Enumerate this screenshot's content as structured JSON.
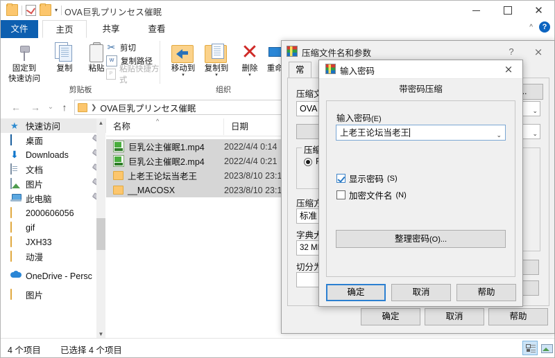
{
  "explorer": {
    "title": "OVA巨乳プリンセス催眠",
    "quick_access_icons": [
      "folder-icon",
      "properties-icon",
      "new-folder-icon",
      "customize-caret-icon"
    ],
    "window_buttons": {
      "minimize": "minimize-icon",
      "maximize": "maximize-icon",
      "close": "close-icon"
    },
    "help_expand": "^",
    "help": "?",
    "tabs": [
      {
        "label": "文件",
        "name": "tab-file"
      },
      {
        "label": "主页",
        "name": "tab-home"
      },
      {
        "label": "共享",
        "name": "tab-share"
      },
      {
        "label": "查看",
        "name": "tab-view"
      }
    ],
    "ribbon": {
      "groups": [
        {
          "name": "剪贴板"
        },
        {
          "name": "组织"
        }
      ],
      "clipboard": {
        "pin_label_line1": "固定到",
        "pin_label_line2": "快速访问",
        "copy": "复制",
        "paste": "粘贴",
        "cut": "剪切",
        "copy_path": "复制路径",
        "paste_shortcut": "粘贴快捷方式"
      },
      "organize": {
        "move_to": "移动到",
        "copy_to": "复制到",
        "delete": "删除",
        "rename": "重命名"
      }
    },
    "address": {
      "back": "←",
      "forward": "→",
      "recent": "⌄",
      "up": "↑",
      "crumb": "OVA巨乳プリンセス催眠",
      "dropdown": "⌄"
    },
    "nav_pane": {
      "items": [
        {
          "label": "快速访问",
          "icon": "star-icon",
          "selected": true,
          "pinned": false
        },
        {
          "label": "桌面",
          "icon": "desktop-icon",
          "selected": false,
          "pinned": true
        },
        {
          "label": "Downloads",
          "icon": "download-icon",
          "selected": false,
          "pinned": true
        },
        {
          "label": "文档",
          "icon": "documents-icon",
          "selected": false,
          "pinned": true
        },
        {
          "label": "图片",
          "icon": "pictures-icon",
          "selected": false,
          "pinned": true
        },
        {
          "label": "此电脑",
          "icon": "this-pc-icon",
          "selected": false,
          "pinned": true
        },
        {
          "label": "2000606056",
          "icon": "folder-icon",
          "selected": false,
          "pinned": false
        },
        {
          "label": "gif",
          "icon": "folder-icon",
          "selected": false,
          "pinned": false
        },
        {
          "label": "JXH33",
          "icon": "folder-icon",
          "selected": false,
          "pinned": false
        },
        {
          "label": "动漫",
          "icon": "folder-icon",
          "selected": false,
          "pinned": false
        },
        {
          "label": "OneDrive - Persc",
          "icon": "onedrive-icon",
          "selected": false,
          "pinned": false
        },
        {
          "label": "图片",
          "icon": "folder-icon",
          "selected": false,
          "pinned": false
        }
      ]
    },
    "file_list": {
      "columns": [
        "名称",
        "日期"
      ],
      "sort_indicator": "^",
      "rows": [
        {
          "name": "巨乳公主催眠1.mp4",
          "date": "2022/4/4 0:14",
          "icon": "mp4-file-icon",
          "selected": true
        },
        {
          "name": "巨乳公主催眠2.mp4",
          "date": "2022/4/4 0:21",
          "icon": "mp4-file-icon",
          "selected": true
        },
        {
          "name": "上老王论坛当老王",
          "date": "2023/8/10 23:1",
          "icon": "folder-icon",
          "selected": true
        },
        {
          "name": "__MACOSX",
          "date": "2023/8/10 23:1",
          "icon": "folder-icon",
          "selected": true
        }
      ]
    },
    "status": {
      "count": "4 个项目",
      "selected": "已选择 4 个项目",
      "view_details": "details-view-icon",
      "view_tiles": "large-icons-view-icon"
    }
  },
  "winrar": {
    "title": "压缩文件名和参数",
    "icon": "winrar-icon",
    "help": "?",
    "close": "×",
    "tabs": [
      {
        "label": "常规"
      }
    ],
    "archive_name_label": "压缩文",
    "archive_name_value": "OVA巨",
    "browse_button": "(B)...",
    "profiles_button": "",
    "format_group": "压缩",
    "format_rar": "RA",
    "method_label": "压缩方",
    "method_value": "标准",
    "dict_label": "字典大",
    "dict_value": "32 MB",
    "split_label": "切分为",
    "split_value": "",
    "buttons": {
      "ok": "确定",
      "cancel": "取消",
      "help": "帮助"
    }
  },
  "password_dialog": {
    "title": "输入密码",
    "icon": "winrar-icon",
    "close": "×",
    "header": "带密码压缩",
    "password_label": "输入密码",
    "password_label_mnemonic": "(E)",
    "password_value": "上老王论坛当老王",
    "password_placeholder": "",
    "show_password_label": "显示密码",
    "show_password_mnemonic": "(S)",
    "show_password_checked": true,
    "encrypt_names_label": "加密文件名",
    "encrypt_names_mnemonic": "(N)",
    "encrypt_names_checked": false,
    "organize_button": "整理密码",
    "organize_button_mnemonic": "(O)...",
    "buttons": {
      "ok": "确定",
      "cancel": "取消",
      "help": "帮助"
    }
  },
  "colors": {
    "accent_blue": "#0d5fb0",
    "selection_gray": "#d6d6d6",
    "dialog_bg": "#f0f0f0",
    "focus_blue": "#2b7fd1",
    "folder_yellow": "#fcc66d"
  }
}
